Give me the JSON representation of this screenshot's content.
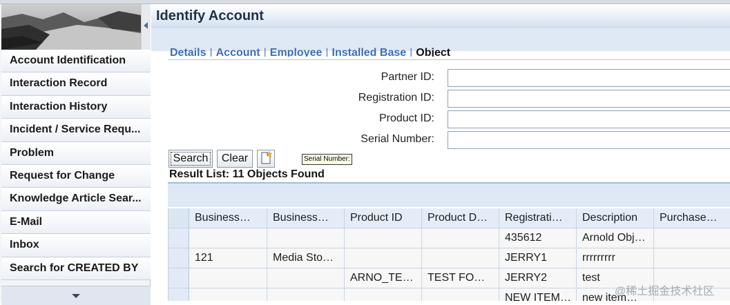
{
  "nav": {
    "items": [
      {
        "label": "Account Identification"
      },
      {
        "label": "Interaction Record"
      },
      {
        "label": "Interaction History"
      },
      {
        "label": "Incident / Service Requ..."
      },
      {
        "label": "Problem"
      },
      {
        "label": "Request for Change"
      },
      {
        "label": "Knowledge Article Sear..."
      },
      {
        "label": "E-Mail"
      },
      {
        "label": "Inbox"
      },
      {
        "label": "Search for CREATED BY"
      }
    ]
  },
  "page": {
    "title": "Identify Account"
  },
  "tabs": [
    {
      "label": "Details"
    },
    {
      "label": "Account"
    },
    {
      "label": "Employee"
    },
    {
      "label": "Installed Base"
    },
    {
      "label": "Object",
      "active": true
    }
  ],
  "tab_separator": "|",
  "form": {
    "fields": [
      {
        "label": "Partner ID:",
        "value": ""
      },
      {
        "label": "Registration ID:",
        "value": ""
      },
      {
        "label": "Product ID:",
        "value": ""
      },
      {
        "label": "Serial Number:",
        "value": ""
      }
    ]
  },
  "buttons": {
    "search": "Search",
    "clear": "Clear",
    "new_icon": "new-document-icon"
  },
  "tooltip": "Serial Number:",
  "results": {
    "title": "Result List: 11 Objects Found",
    "columns": [
      "Business…",
      "Business…",
      "Product ID",
      "Product D…",
      "Registrati…",
      "Description",
      "Purchase…"
    ],
    "rows": [
      [
        "",
        "",
        "",
        "",
        "435612",
        "Arnold Obj…",
        ""
      ],
      [
        "121",
        "Media Sto…",
        "",
        "",
        "JERRY1",
        "rrrrrrrrr",
        ""
      ],
      [
        "",
        "",
        "ARNO_TE…",
        "TEST FO…",
        "JERRY2",
        "test",
        ""
      ],
      [
        "",
        "",
        "",
        "",
        "NEW ITEM…",
        "new item…",
        ""
      ]
    ]
  },
  "watermark": "@稀土掘金技术社区",
  "colors": {
    "title_text": "#1f3148",
    "tab_link": "#3b6eb5",
    "header_bg": "#e4edf7"
  }
}
